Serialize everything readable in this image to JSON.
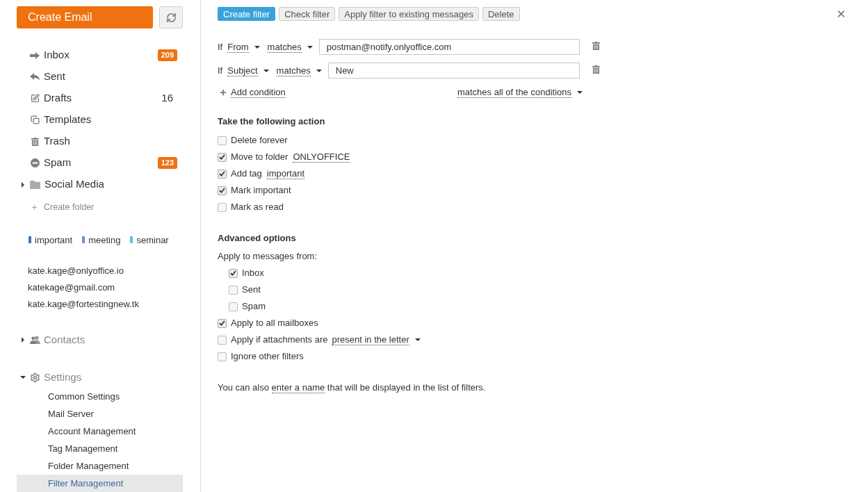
{
  "sidebar": {
    "create_button": "Create Email",
    "folders": [
      {
        "label": "Inbox",
        "badge": "209"
      },
      {
        "label": "Sent"
      },
      {
        "label": "Drafts",
        "count": "16"
      },
      {
        "label": "Templates"
      },
      {
        "label": "Trash"
      },
      {
        "label": "Spam",
        "badge": "123"
      }
    ],
    "user_folders": [
      {
        "label": "Social Media",
        "expanded": false
      }
    ],
    "create_folder": "Create folder",
    "tags": [
      {
        "label": "important",
        "color": "#3f72ad"
      },
      {
        "label": "meeting",
        "color": "#6e95cc"
      },
      {
        "label": "seminar",
        "color": "#63c0dc"
      }
    ],
    "accounts": [
      "kate.kage@onlyoffice.io",
      "katekage@gmail.com",
      "kate.kage@fortestingnew.tk"
    ],
    "sections": [
      {
        "label": "Contacts",
        "expanded": false
      },
      {
        "label": "Settings",
        "expanded": true,
        "children": [
          {
            "label": "Common Settings",
            "selected": false
          },
          {
            "label": "Mail Server",
            "selected": false
          },
          {
            "label": "Account Management",
            "selected": false
          },
          {
            "label": "Tag Management",
            "selected": false
          },
          {
            "label": "Folder Management",
            "selected": false
          },
          {
            "label": "Filter Management",
            "selected": true
          }
        ]
      }
    ]
  },
  "main": {
    "toolbar": [
      {
        "label": "Create filter",
        "kind": "primary"
      },
      {
        "label": "Check filter",
        "kind": "default"
      },
      {
        "label": "Apply filter to existing messages",
        "kind": "default"
      },
      {
        "label": "Delete",
        "kind": "default"
      }
    ],
    "conditions": [
      {
        "prefix": "If",
        "field": "From",
        "operator": "matches",
        "value": "postman@notify.onlyoffice.com"
      },
      {
        "prefix": "If",
        "field": "Subject",
        "operator": "matches",
        "value": "New"
      }
    ],
    "add_condition": "Add condition",
    "match_mode": "matches all of the conditions",
    "actions": {
      "title": "Take the following action",
      "items": [
        {
          "label": "Delete forever",
          "checked": false
        },
        {
          "label": "Move to folder",
          "checked": true,
          "link": "ONLYOFFICE"
        },
        {
          "label": "Add tag",
          "checked": true,
          "link": "important"
        },
        {
          "label": "Mark important",
          "checked": true
        },
        {
          "label": "Mark as read",
          "checked": false
        }
      ]
    },
    "advanced": {
      "title": "Advanced options",
      "sources_label": "Apply to messages from:",
      "sources": [
        {
          "label": "Inbox",
          "checked": true
        },
        {
          "label": "Sent",
          "checked": false
        },
        {
          "label": "Spam",
          "checked": false
        }
      ],
      "options": [
        {
          "label": "Apply to all mailboxes",
          "checked": true
        },
        {
          "label": "Apply if attachments are",
          "checked": false,
          "dropdown": "present in the letter"
        },
        {
          "label": "Ignore other filters",
          "checked": false
        }
      ]
    },
    "note": {
      "before": "You can also ",
      "link": "enter a name",
      "after": " that will be displayed in the list of filters."
    }
  }
}
